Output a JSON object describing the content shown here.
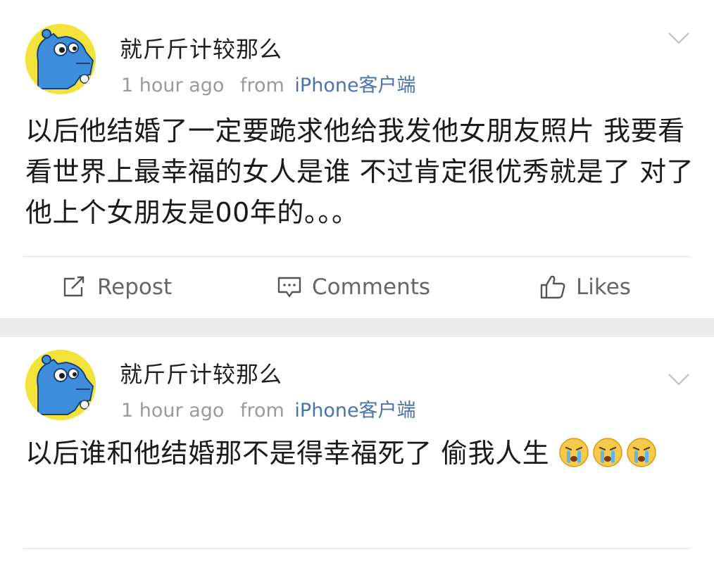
{
  "posts": [
    {
      "username": "就斤斤计较那么",
      "time": "1 hour ago",
      "from_label": "from",
      "source": "iPhone客户端",
      "text": "以后他结婚了一定要跪求他给我发他女朋友照片 我要看看世界上最幸福的女人是谁 不过肯定很优秀就是了 对了他上个女朋友是00年的。。。",
      "actions": {
        "repost_label": "Repost",
        "comments_label": "Comments",
        "likes_label": "Likes"
      }
    },
    {
      "username": "就斤斤计较那么",
      "time": "1 hour ago",
      "from_label": "from",
      "source": "iPhone客户端",
      "text": "以后谁和他结婚那不是得幸福死了 偷我人生",
      "emoji": [
        "crying-face",
        "crying-face",
        "crying-face"
      ]
    }
  ],
  "colors": {
    "source_link": "#4a74a8",
    "meta_gray": "#9a9a9a",
    "separator": "#ececec",
    "avatar_bg": "#f2e23a",
    "avatar_figure": "#3d8fdc"
  },
  "icons": {
    "avatar": "blue-hippo-pixel-avatar",
    "menu": "chevron-down-icon",
    "repost": "share-box-arrow-icon",
    "comments": "comment-bubble-icon",
    "likes": "thumbs-up-icon"
  }
}
